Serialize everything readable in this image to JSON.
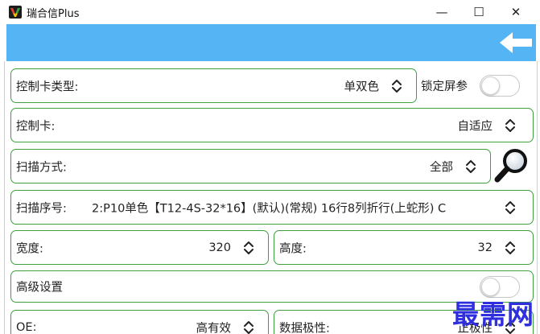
{
  "window": {
    "title": "瑞合信Plus",
    "minimize_glyph": "—",
    "maximize_glyph": "☐",
    "close_glyph": "✕"
  },
  "header": {
    "back_icon": "left-arrow-icon",
    "accent_color": "#55b4f3"
  },
  "form": {
    "card_type": {
      "label": "控制卡类型:",
      "value": "单双色"
    },
    "lock_screen": {
      "label": "锁定屏参",
      "checked": false
    },
    "controller": {
      "label": "控制卡:",
      "value": "自适应"
    },
    "scan_mode": {
      "label": "扫描方式:",
      "value": "全部"
    },
    "scan_number": {
      "label": "扫描序号:",
      "value": "2:P10单色【T12-4S-32*16】(默认)(常规) 16行8列折行(上蛇形) C"
    },
    "width": {
      "label": "宽度:",
      "value": "320"
    },
    "height": {
      "label": "高度:",
      "value": "32"
    },
    "advanced": {
      "label": "高级设置",
      "checked": false
    },
    "oe": {
      "label": "OE:",
      "value": "高有效"
    },
    "data_polarity": {
      "label": "数据极性:",
      "value": "正极性"
    }
  },
  "watermark": "最需网",
  "colors": {
    "border_green": "#3fa03f",
    "header_blue": "#55b4f3",
    "watermark_blue": "#2f2fe0"
  }
}
